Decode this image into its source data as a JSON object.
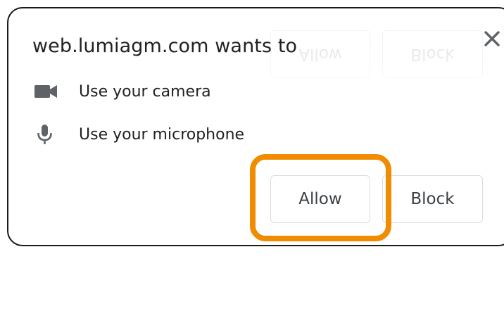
{
  "dialog": {
    "title": "web.lumiagm.com wants to",
    "close_icon": "close-icon",
    "permissions": [
      {
        "icon": "camera-icon",
        "label": "Use your camera"
      },
      {
        "icon": "microphone-icon",
        "label": "Use your microphone"
      }
    ],
    "allow_label": "Allow",
    "block_label": "Block"
  },
  "colors": {
    "highlight": "#f08c00",
    "text": "#202124",
    "icon": "#5f6368",
    "button_border": "#dadce0"
  }
}
